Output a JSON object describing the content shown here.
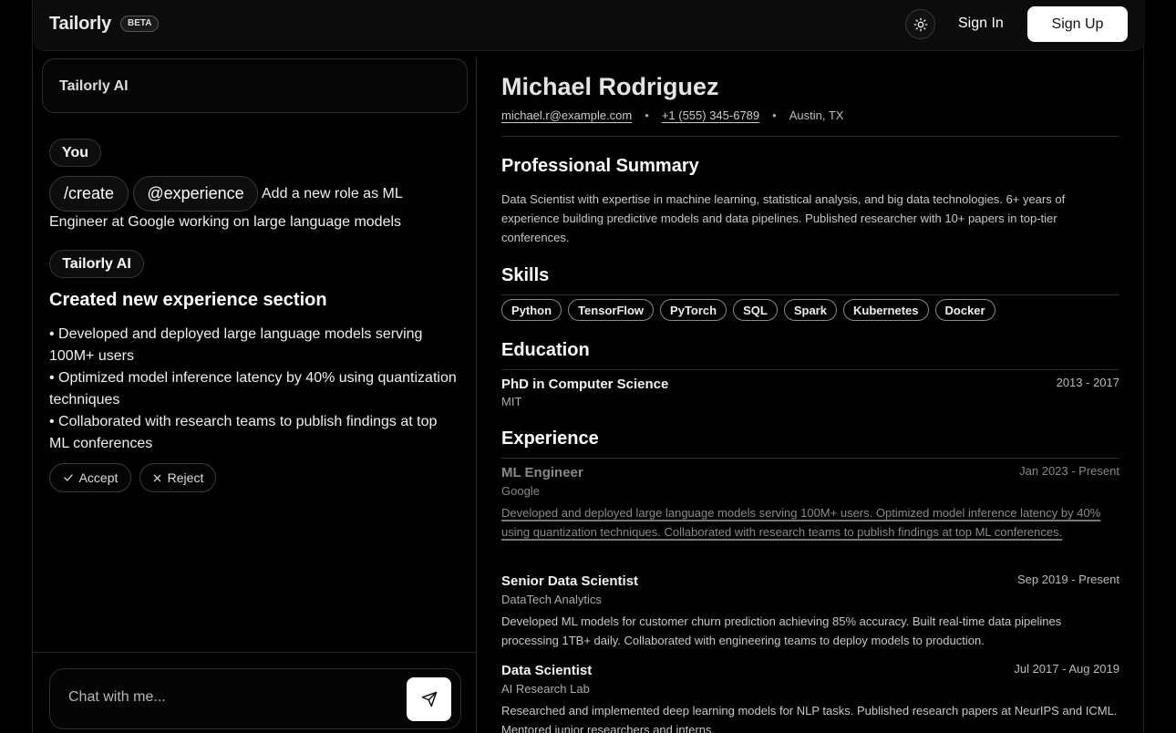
{
  "header": {
    "logo": "Tailorly",
    "badge": "BETA",
    "theme_icon": "sun-icon",
    "sign_in": "Sign In",
    "sign_up": "Sign Up"
  },
  "chat": {
    "header_title": "Tailorly AI",
    "user_label": "You",
    "user_commands": [
      "/create",
      "@experience"
    ],
    "user_message_line1": "Add a new role as ML",
    "user_message_line2": "Engineer at Google working on large language models",
    "ai_label": "Tailorly AI",
    "ai_title": "Created new experience section",
    "ai_bullets": [
      "• Developed and deployed large language models serving 100M+ users",
      "• Optimized model inference latency by 40% using quantization techniques",
      "• Collaborated with research teams to publish findings at top ML conferences"
    ],
    "accept_label": "Accept",
    "reject_label": "Reject",
    "input_placeholder": "Chat with me...",
    "send_icon": "send-icon"
  },
  "resume": {
    "name": "Michael Rodriguez",
    "email": "michael.r@example.com",
    "phone": "+1 (555) 345-6789",
    "location": "Austin, TX",
    "summary_heading": "Professional Summary",
    "summary": "Data Scientist with expertise in machine learning, statistical analysis, and big data technologies. 6+ years of experience building predictive models and data pipelines. Published researcher with 10+ papers in top-tier conferences.",
    "skills_heading": "Skills",
    "skills": [
      "Python",
      "TensorFlow",
      "PyTorch",
      "SQL",
      "Spark",
      "Kubernetes",
      "Docker"
    ],
    "education_heading": "Education",
    "education": {
      "degree": "PhD in Computer Science",
      "school": "MIT",
      "dates": "2013 - 2017"
    },
    "experience_heading": "Experience",
    "experience": [
      {
        "title": "ML Engineer",
        "company": "Google",
        "dates": "Jan 2023 - Present",
        "description": "Developed and deployed large language models serving 100M+ users. Optimized model inference latency by 40% using quantization techniques. Collaborated with research teams to publish findings at top ML conferences."
      },
      {
        "title": "Senior Data Scientist",
        "company": "DataTech Analytics",
        "dates": "Sep 2019 - Present",
        "description": "Developed ML models for customer churn prediction achieving 85% accuracy. Built real-time data pipelines processing 1TB+ daily. Collaborated with engineering teams to deploy models to production."
      },
      {
        "title": "Data Scientist",
        "company": "AI Research Lab",
        "dates": "Jul 2017 - Aug 2019",
        "description": "Researched and implemented deep learning models for NLP tasks. Published research papers at NeurIPS and ICML. Mentored junior researchers and interns."
      }
    ]
  }
}
